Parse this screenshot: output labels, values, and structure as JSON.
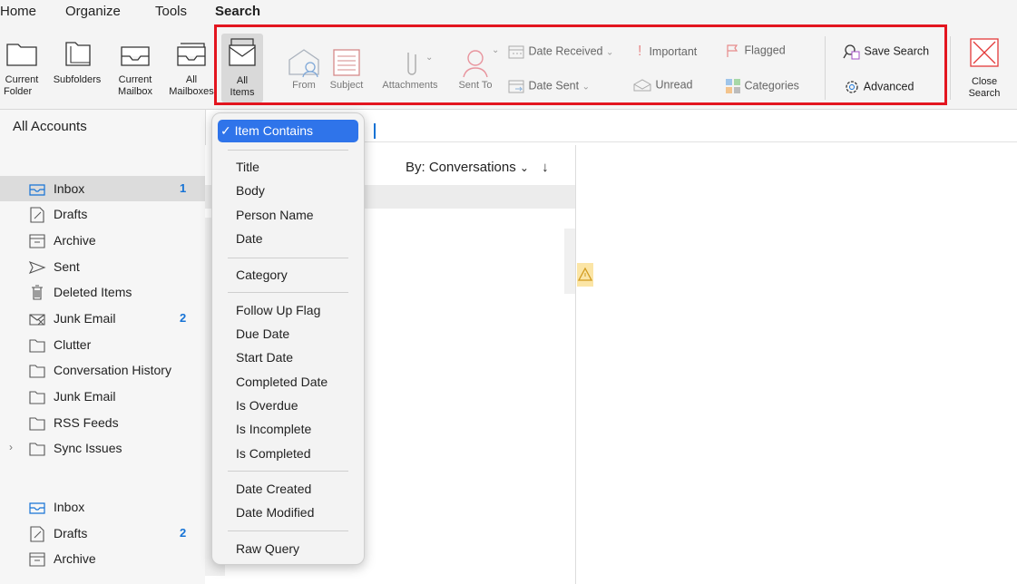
{
  "menubar": {
    "home": "Home",
    "organize": "Organize",
    "tools": "Tools",
    "search": "Search"
  },
  "ribbon": {
    "current_folder": [
      "Current",
      "Folder"
    ],
    "subfolders": "Subfolders",
    "current_mailbox": [
      "Current",
      "Mailbox"
    ],
    "all_mailboxes": [
      "All",
      "Mailboxes"
    ],
    "all_items": [
      "All",
      "Items"
    ],
    "from": "From",
    "subject": "Subject",
    "attachments": "Attachments",
    "sent_to": "Sent To",
    "date_received": "Date Received",
    "date_sent": "Date Sent",
    "important": "Important",
    "unread": "Unread",
    "flagged": "Flagged",
    "categories": "Categories",
    "save_search": "Save Search",
    "advanced": "Advanced",
    "close_search": [
      "Close",
      "Search"
    ]
  },
  "sidebar": {
    "account": "All Accounts",
    "folders": [
      {
        "label": "Inbox",
        "count": "1"
      },
      {
        "label": "Drafts",
        "count": ""
      },
      {
        "label": "Archive",
        "count": ""
      },
      {
        "label": "Sent",
        "count": ""
      },
      {
        "label": "Deleted Items",
        "count": ""
      },
      {
        "label": "Junk Email",
        "count": "2"
      },
      {
        "label": "Clutter",
        "count": ""
      },
      {
        "label": "Conversation History",
        "count": ""
      },
      {
        "label": "Junk Email",
        "count": ""
      },
      {
        "label": "RSS Feeds",
        "count": ""
      },
      {
        "label": "Sync Issues",
        "count": ""
      },
      {
        "label": "Inbox",
        "count": ""
      },
      {
        "label": "Drafts",
        "count": "2"
      },
      {
        "label": "Archive",
        "count": ""
      }
    ]
  },
  "list": {
    "sort_label": "By: Conversations"
  },
  "dropdown": {
    "selected": "✓ Item Contains",
    "items": [
      "Title",
      "Body",
      "Person Name",
      "Date",
      "Category",
      "Follow Up Flag",
      "Due Date",
      "Start Date",
      "Completed Date",
      "Is Overdue",
      "Is Incomplete",
      "Is Completed",
      "Date Created",
      "Date Modified",
      "Raw Query"
    ]
  },
  "colors": {
    "accent": "#2f74ea",
    "highlight_box": "#e3151f",
    "count": "#1673d6"
  }
}
